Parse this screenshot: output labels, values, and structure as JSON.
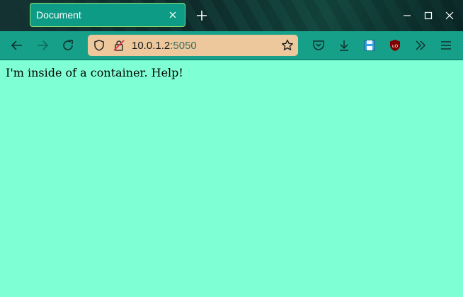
{
  "tab": {
    "title": "Document"
  },
  "url": {
    "host": "10.0.1.2",
    "port": ":5050"
  },
  "page": {
    "text": "I'm inside of a container. Help!"
  },
  "colors": {
    "page_bg": "#7fffd4",
    "toolbar": "#16a08a",
    "tab": "#0e9b86",
    "urlbar": "#ecc89c"
  },
  "icons": [
    "close-icon",
    "plus-icon",
    "minimize-icon",
    "maximize-icon",
    "back-icon",
    "forward-icon",
    "reload-icon",
    "shield-icon",
    "insecure-lock-icon",
    "star-icon",
    "pocket-icon",
    "download-icon",
    "save-icon",
    "ublock-icon",
    "overflow-icon",
    "menu-icon"
  ]
}
